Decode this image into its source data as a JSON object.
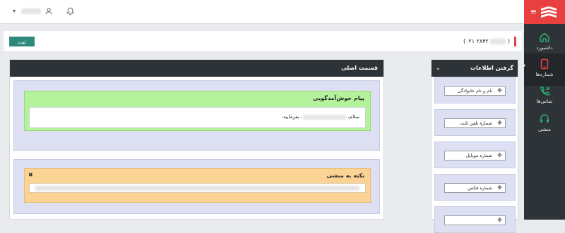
{
  "nav": {
    "items": [
      {
        "label": "داشبورد",
        "icon": "home-icon",
        "active": false
      },
      {
        "label": "شماره‌ها",
        "icon": "phone-book-icon",
        "active": true
      },
      {
        "label": "تماس‌ها",
        "icon": "call-icon",
        "active": false
      },
      {
        "label": "منشی",
        "icon": "secretary-icon",
        "active": false
      }
    ]
  },
  "topbar": {
    "user_icon": "user-icon",
    "bell_icon": "bell-icon",
    "dropdown_icon": "caret-down-icon"
  },
  "header": {
    "submit_label": "ثبت",
    "phone_prefix": "(۰۲۱",
    "phone_visible": "۲۸۴۲",
    "phone_suffix": ")"
  },
  "main_panel": {
    "title": "قسمت اصلی",
    "welcome": {
      "title": "پیام خوش‌آمدگویی",
      "text_start": "سلام،",
      "text_end": "، بفرمایید."
    },
    "note": {
      "title": "نکته به منشی",
      "close_icon": "close-icon"
    }
  },
  "info_panel": {
    "title": "گرفتن اطلاعات",
    "collapse_icon": "chevron-down-icon",
    "fields": [
      {
        "label": "نام و نام خانوادگی"
      },
      {
        "label": "شماره تلفن ثابت"
      },
      {
        "label": "شماره موبایل"
      },
      {
        "label": "شماره فکس"
      },
      {
        "label": ""
      }
    ],
    "move_icon": "move-icon"
  },
  "colors": {
    "brand": "#e8403f",
    "sidebar": "#2e3338",
    "accent": "#2f8a7e",
    "green_icons": "#2fae72"
  }
}
